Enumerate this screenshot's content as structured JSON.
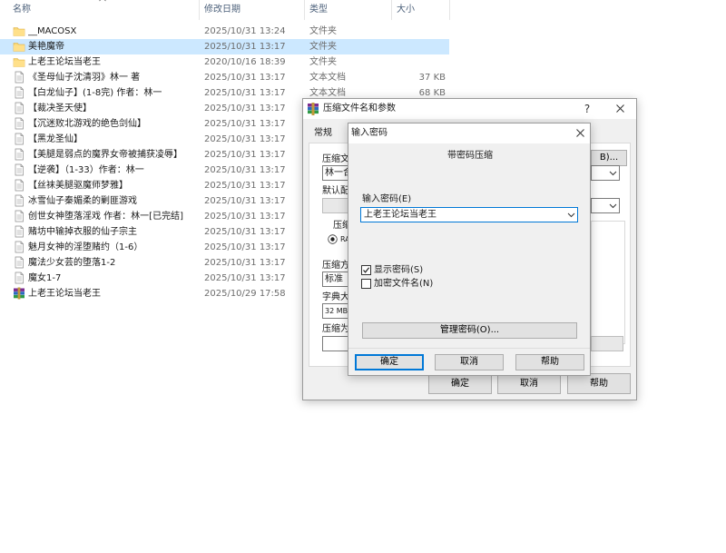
{
  "explorer": {
    "columns": {
      "name": "名称",
      "date": "修改日期",
      "type": "类型",
      "size": "大小"
    },
    "files": [
      {
        "name": "__MACOSX",
        "date": "2025/10/31 13:24",
        "type": "文件夹",
        "size": "",
        "icon": "folder-icon",
        "selected": false
      },
      {
        "name": "美艳魔帝",
        "date": "2025/10/31 13:17",
        "type": "文件夹",
        "size": "",
        "icon": "folder-icon",
        "selected": true
      },
      {
        "name": "上老王论坛当老王",
        "date": "2020/10/16 18:39",
        "type": "文件夹",
        "size": "",
        "icon": "folder-icon",
        "selected": false
      },
      {
        "name": "《圣母仙子沈清羽》林一 著",
        "date": "2025/10/31 13:17",
        "type": "文本文档",
        "size": "37 KB",
        "icon": "text-file-icon",
        "selected": false
      },
      {
        "name": "【白龙仙子】(1-8完) 作者：林一",
        "date": "2025/10/31 13:17",
        "type": "文本文档",
        "size": "68 KB",
        "icon": "text-file-icon",
        "selected": false
      },
      {
        "name": "【裁决圣天使】",
        "date": "2025/10/31 13:17",
        "type": "",
        "size": "",
        "icon": "text-file-icon",
        "selected": false
      },
      {
        "name": "【沉迷败北游戏的绝色剑仙】",
        "date": "2025/10/31 13:17",
        "type": "",
        "size": "",
        "icon": "text-file-icon",
        "selected": false
      },
      {
        "name": "【黑龙圣仙】",
        "date": "2025/10/31 13:17",
        "type": "",
        "size": "",
        "icon": "text-file-icon",
        "selected": false
      },
      {
        "name": "【美腿是弱点的魔界女帝被捕获凌辱】",
        "date": "2025/10/31 13:17",
        "type": "",
        "size": "",
        "icon": "text-file-icon",
        "selected": false
      },
      {
        "name": "【逆袭】（1-33）作者：林一",
        "date": "2025/10/31 13:17",
        "type": "",
        "size": "",
        "icon": "text-file-icon",
        "selected": false
      },
      {
        "name": "【丝袜美腿驱魔师梦雅】",
        "date": "2025/10/31 13:17",
        "type": "",
        "size": "",
        "icon": "text-file-icon",
        "selected": false
      },
      {
        "name": "冰雪仙子秦媚柔的剿匪游戏",
        "date": "2025/10/31 13:17",
        "type": "",
        "size": "",
        "icon": "text-file-icon",
        "selected": false
      },
      {
        "name": "创世女神堕落淫戏 作者：林一[已完结]",
        "date": "2025/10/31 13:17",
        "type": "",
        "size": "",
        "icon": "text-file-icon",
        "selected": false
      },
      {
        "name": "赌坊中输掉衣服的仙子宗主",
        "date": "2025/10/31 13:17",
        "type": "",
        "size": "",
        "icon": "text-file-icon",
        "selected": false
      },
      {
        "name": "魅月女神的淫堕赌约（1-6）",
        "date": "2025/10/31 13:17",
        "type": "",
        "size": "",
        "icon": "text-file-icon",
        "selected": false
      },
      {
        "name": "魔法少女芸的堕落1-2",
        "date": "2025/10/31 13:17",
        "type": "",
        "size": "",
        "icon": "text-file-icon",
        "selected": false
      },
      {
        "name": "魔女1-7",
        "date": "2025/10/31 13:17",
        "type": "",
        "size": "",
        "icon": "text-file-icon",
        "selected": false
      },
      {
        "name": "上老王论坛当老王",
        "date": "2025/10/29 17:58",
        "type": "",
        "size": "",
        "icon": "winrar-archive-icon",
        "selected": false
      }
    ]
  },
  "compress_dialog": {
    "title": "压缩文件名和参数",
    "help_glyph": "?",
    "close_glyph": "✕",
    "tab_general": "常规",
    "archive_name_label": "压缩文",
    "archive_name_value": "林一合",
    "browse_button": "B)...",
    "default_profile_label": "默认配",
    "format_label": "压缩",
    "format_option": "RA",
    "method_label": "压缩方",
    "method_value": "标准",
    "dict_label": "字典大",
    "dict_value": "32 MB",
    "split_label": "压缩为",
    "ok": "确定",
    "cancel": "取消",
    "help": "帮助"
  },
  "password_dialog": {
    "title": "输入密码",
    "close_glyph": "✕",
    "heading": "带密码压缩",
    "enter_label": "输入密码(E)",
    "password_value": "上老王论坛当老王",
    "show_password_label": "显示密码(S)",
    "show_password_checked": true,
    "encrypt_names_label": "加密文件名(N)",
    "encrypt_names_checked": false,
    "manage_button": "管理密码(O)...",
    "ok": "确定",
    "cancel": "取消",
    "help": "帮助"
  }
}
